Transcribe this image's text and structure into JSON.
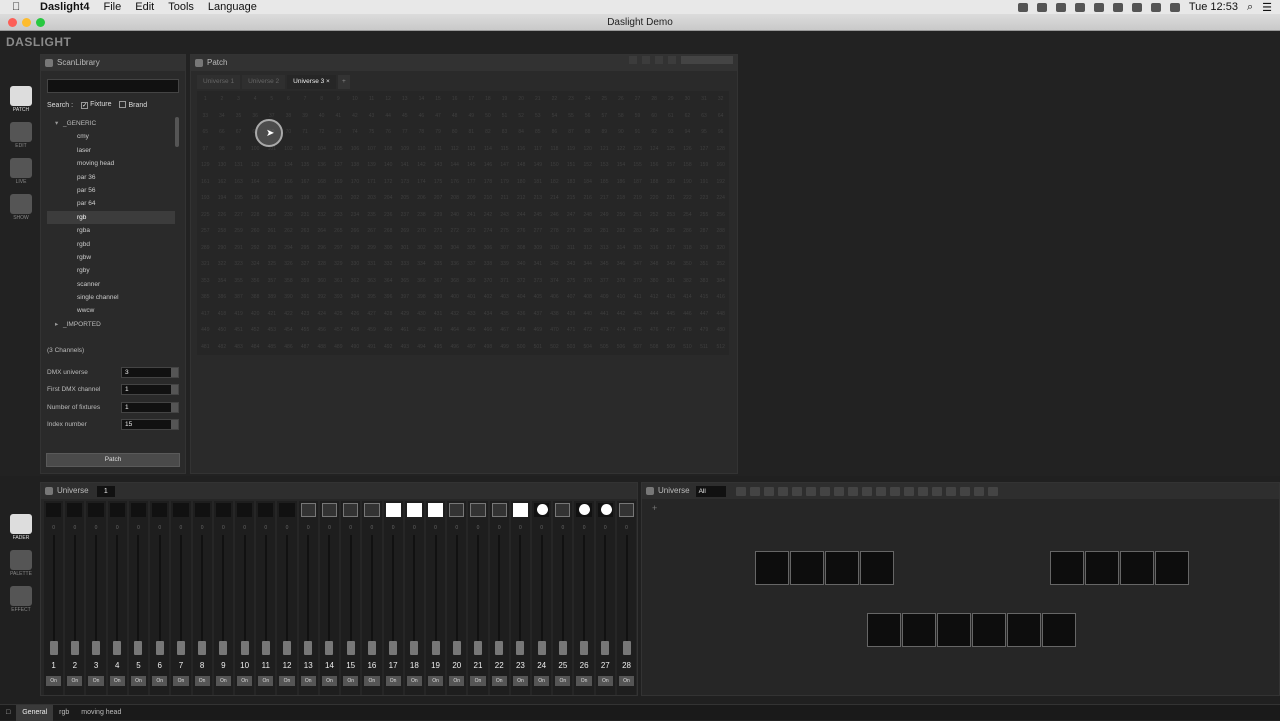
{
  "menubar": {
    "app_name": "Daslight4",
    "items": [
      "File",
      "Edit",
      "Tools",
      "Language"
    ],
    "clock": "Tue 12:53"
  },
  "window": {
    "title": "Daslight Demo"
  },
  "brand": "DASLIGHT",
  "left_nav": {
    "patch": "PATCH",
    "edit": "EDIT",
    "live": "LIVE",
    "show": "SHOW"
  },
  "bottom_nav": {
    "fader": "FADER",
    "palette": "PALETTE",
    "effect": "EFFECT"
  },
  "scanlibrary": {
    "title": "ScanLibrary",
    "search_label": "Search :",
    "fixture_label": "Fixture",
    "brand_label": "Brand",
    "tree": [
      {
        "label": "_GENERIC",
        "kind": "group",
        "open": true
      },
      {
        "label": "cmy"
      },
      {
        "label": "laser"
      },
      {
        "label": "moving head"
      },
      {
        "label": "par 36"
      },
      {
        "label": "par 56"
      },
      {
        "label": "par 64"
      },
      {
        "label": "rgb",
        "selected": true
      },
      {
        "label": "rgba"
      },
      {
        "label": "rgbd"
      },
      {
        "label": "rgbw"
      },
      {
        "label": "rgby"
      },
      {
        "label": "scanner"
      },
      {
        "label": "single channel"
      },
      {
        "label": "wwcw"
      },
      {
        "label": "_IMPORTED",
        "kind": "group",
        "open": false
      }
    ],
    "channels_info": "(3 Channels)",
    "params": {
      "dmx_universe": {
        "label": "DMX universe",
        "value": "3"
      },
      "first_channel": {
        "label": "First DMX channel",
        "value": "1"
      },
      "num_fixtures": {
        "label": "Number of fixtures",
        "value": "1"
      },
      "index_number": {
        "label": "Index number",
        "value": "15"
      }
    },
    "patch_button": "Patch"
  },
  "patch": {
    "title": "Patch",
    "tabs": [
      "Universe 1",
      "Universe 2",
      "Universe 3"
    ],
    "active_tab": 2,
    "close_glyph": "×",
    "add_glyph": "+"
  },
  "fader": {
    "title": "Universe",
    "universe": "1",
    "on_label": "On",
    "zero_label": "0",
    "channels": [
      {
        "n": "1",
        "sw": "black"
      },
      {
        "n": "2",
        "sw": "black"
      },
      {
        "n": "3",
        "sw": "black"
      },
      {
        "n": "4",
        "sw": "black"
      },
      {
        "n": "5",
        "sw": "black"
      },
      {
        "n": "6",
        "sw": "black"
      },
      {
        "n": "7",
        "sw": "black"
      },
      {
        "n": "8",
        "sw": "black"
      },
      {
        "n": "9",
        "sw": "black"
      },
      {
        "n": "10",
        "sw": "black"
      },
      {
        "n": "11",
        "sw": "black"
      },
      {
        "n": "12",
        "sw": "black"
      },
      {
        "n": "13",
        "sw": "icon"
      },
      {
        "n": "14",
        "sw": "icon"
      },
      {
        "n": "15",
        "sw": "icon"
      },
      {
        "n": "16",
        "sw": "icon"
      },
      {
        "n": "17",
        "sw": "white"
      },
      {
        "n": "18",
        "sw": "white"
      },
      {
        "n": "19",
        "sw": "white"
      },
      {
        "n": "20",
        "sw": "icon"
      },
      {
        "n": "21",
        "sw": "icon"
      },
      {
        "n": "22",
        "sw": "icon"
      },
      {
        "n": "23",
        "sw": "white"
      },
      {
        "n": "24",
        "sw": "dot"
      },
      {
        "n": "25",
        "sw": "icon"
      },
      {
        "n": "26",
        "sw": "dot"
      },
      {
        "n": "27",
        "sw": "dot"
      },
      {
        "n": "28",
        "sw": "icon"
      }
    ]
  },
  "universe_view": {
    "title": "Universe",
    "filter": "All"
  },
  "statusbar": {
    "tabs": [
      "General",
      "rgb",
      "moving head"
    ]
  }
}
